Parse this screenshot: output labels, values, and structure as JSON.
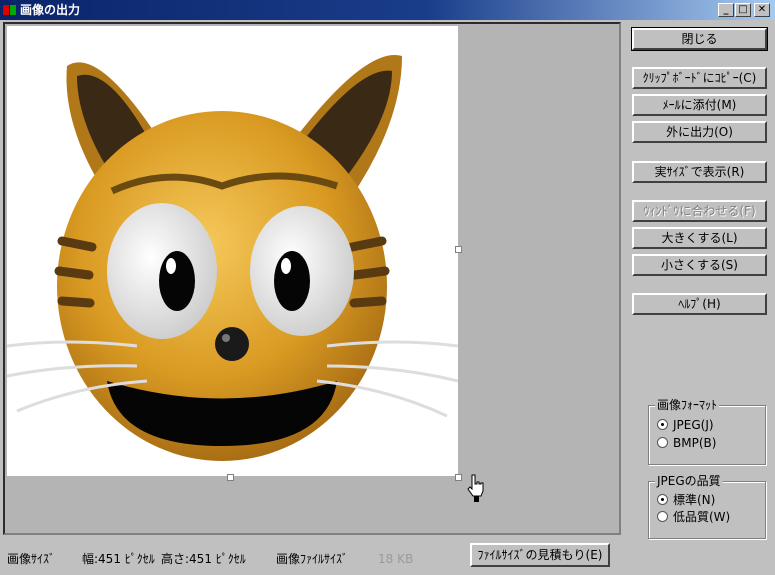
{
  "window": {
    "title": "画像の出力",
    "minimize": "_",
    "maximize": "□",
    "close": "✕"
  },
  "image": {
    "width": 451,
    "height": 451
  },
  "buttons": {
    "close": "閉じる",
    "copy_clipboard": "ｸﾘｯﾌﾟﾎﾞｰﾄﾞにｺﾋﾟｰ(C)",
    "attach_mail": "ﾒｰﾙに添付(M)",
    "export": "外に出力(O)",
    "actual_size": "実ｻｲｽﾞで表示(R)",
    "fit_window": "ｳｨﾝﾄﾞｳに合わせる(F)",
    "zoom_in": "大きくする(L)",
    "zoom_out": "小さくする(S)",
    "help": "ﾍﾙﾌﾟ(H)",
    "estimate": "ﾌｧｲﾙｻｲｽﾞの見積もり(E)"
  },
  "format_group": {
    "label": "画像ﾌｫｰﾏｯﾄ",
    "options": [
      {
        "label": "JPEG(J)",
        "selected": true
      },
      {
        "label": "BMP(B)",
        "selected": false
      }
    ]
  },
  "quality_group": {
    "label": "JPEGの品質",
    "options": [
      {
        "label": "標準(N)",
        "selected": true
      },
      {
        "label": "低品質(W)",
        "selected": false
      }
    ]
  },
  "status": {
    "image_size_label": "画像ｻｲｽﾞ",
    "width_text": "幅:451 ﾋﾟｸｾﾙ",
    "height_text": "高さ:451 ﾋﾟｸｾﾙ",
    "file_size_label": "画像ﾌｧｲﾙｻｲｽﾞ",
    "file_size_value": "18 KB"
  }
}
